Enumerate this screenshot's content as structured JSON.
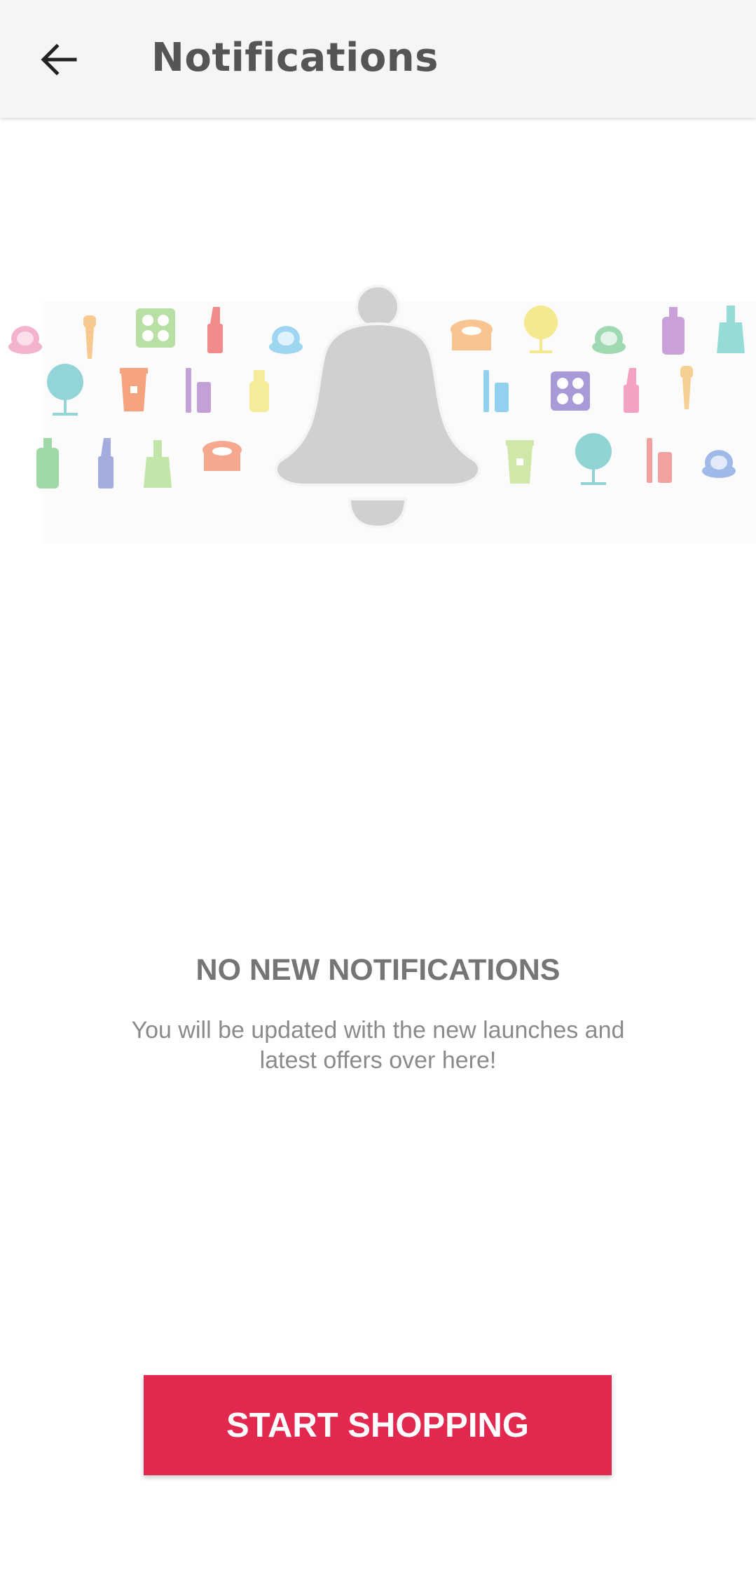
{
  "header": {
    "title": "Notifications",
    "back_icon": "arrow-left-icon"
  },
  "illustration": {
    "main_icon": "bell-icon",
    "decor_icons": [
      "compact-icon",
      "brush-icon",
      "eyeshadow-palette-icon",
      "lipstick-icon",
      "cream-jar-icon",
      "mirror-icon",
      "tube-icon",
      "mascara-icon",
      "bottle-icon",
      "nail-polish-icon"
    ]
  },
  "empty_state": {
    "title": "NO NEW NOTIFICATIONS",
    "subtitle": "You will be updated with the new launches and latest offers over here!"
  },
  "cta": {
    "label": "START SHOPPING",
    "color": "#e2284f"
  }
}
